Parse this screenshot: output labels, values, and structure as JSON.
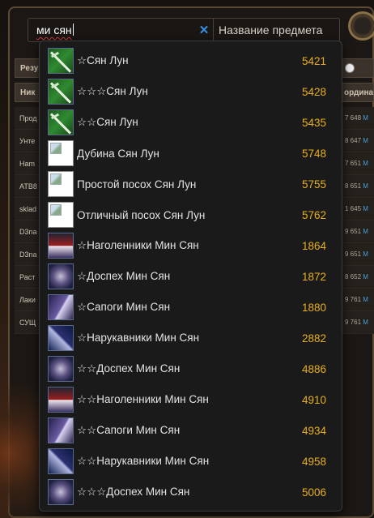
{
  "search": {
    "query": "ми сян",
    "field_label": "Название предмета"
  },
  "background_table": {
    "header_left": "Ник",
    "header_right": "ординат",
    "result_label": "Резу",
    "rows": [
      {
        "left": "Прод",
        "right_num": "7 648",
        "right_tag": "М"
      },
      {
        "left": "Унте",
        "right_num": "8 647",
        "right_tag": "М"
      },
      {
        "left": "Ham",
        "right_num": "7 651",
        "right_tag": "М"
      },
      {
        "left": "ATB8",
        "right_num": "8 651",
        "right_tag": "М"
      },
      {
        "left": "sklad",
        "right_num": "1 645",
        "right_tag": "М"
      },
      {
        "left": "D3na",
        "right_num": "9 651",
        "right_tag": "М"
      },
      {
        "left": "D3na",
        "right_num": "9 651",
        "right_tag": "М"
      },
      {
        "left": "Раст",
        "right_num": "8 652",
        "right_tag": "М"
      },
      {
        "left": "Лаки",
        "right_num": "9 761",
        "right_tag": "М"
      },
      {
        "left": "СУЩ",
        "right_num": "9 761",
        "right_tag": "М"
      }
    ]
  },
  "dropdown": {
    "items": [
      {
        "name": "☆Сян Лун",
        "id": "5421",
        "icon": "jade-staff-icon"
      },
      {
        "name": "☆☆☆Сян Лун",
        "id": "5428",
        "icon": "jade-staff-icon"
      },
      {
        "name": "☆☆Сян Лун",
        "id": "5435",
        "icon": "jade-staff-icon"
      },
      {
        "name": "Дубина Сян Лун",
        "id": "5748",
        "icon": "missing-image-icon"
      },
      {
        "name": "Простой посох Сян Лун",
        "id": "5755",
        "icon": "missing-image-icon"
      },
      {
        "name": "Отличный посох Сян Лун",
        "id": "5762",
        "icon": "missing-image-icon"
      },
      {
        "name": "☆Наголенники Мин Сян",
        "id": "1864",
        "icon": "leggings-icon"
      },
      {
        "name": "☆Доспех Мин Сян",
        "id": "1872",
        "icon": "armor-icon"
      },
      {
        "name": "☆Сапоги Мин Сян",
        "id": "1880",
        "icon": "boots-icon"
      },
      {
        "name": "☆Нарукавники Мин Сян",
        "id": "2882",
        "icon": "bracers-icon"
      },
      {
        "name": "☆☆Доспех Мин Сян",
        "id": "4886",
        "icon": "armor-icon"
      },
      {
        "name": "☆☆Наголенники Мин Сян",
        "id": "4910",
        "icon": "leggings-icon"
      },
      {
        "name": "☆☆Сапоги Мин Сян",
        "id": "4934",
        "icon": "boots-icon"
      },
      {
        "name": "☆☆Нарукавники Мин Сян",
        "id": "4958",
        "icon": "bracers-icon"
      },
      {
        "name": "☆☆☆Доспех Мин Сян",
        "id": "5006",
        "icon": "armor-icon"
      }
    ]
  },
  "colors": {
    "id_color": "#e8b020",
    "clear_icon": "#3a8fe0",
    "dropdown_bg": "#1a1a1a"
  }
}
